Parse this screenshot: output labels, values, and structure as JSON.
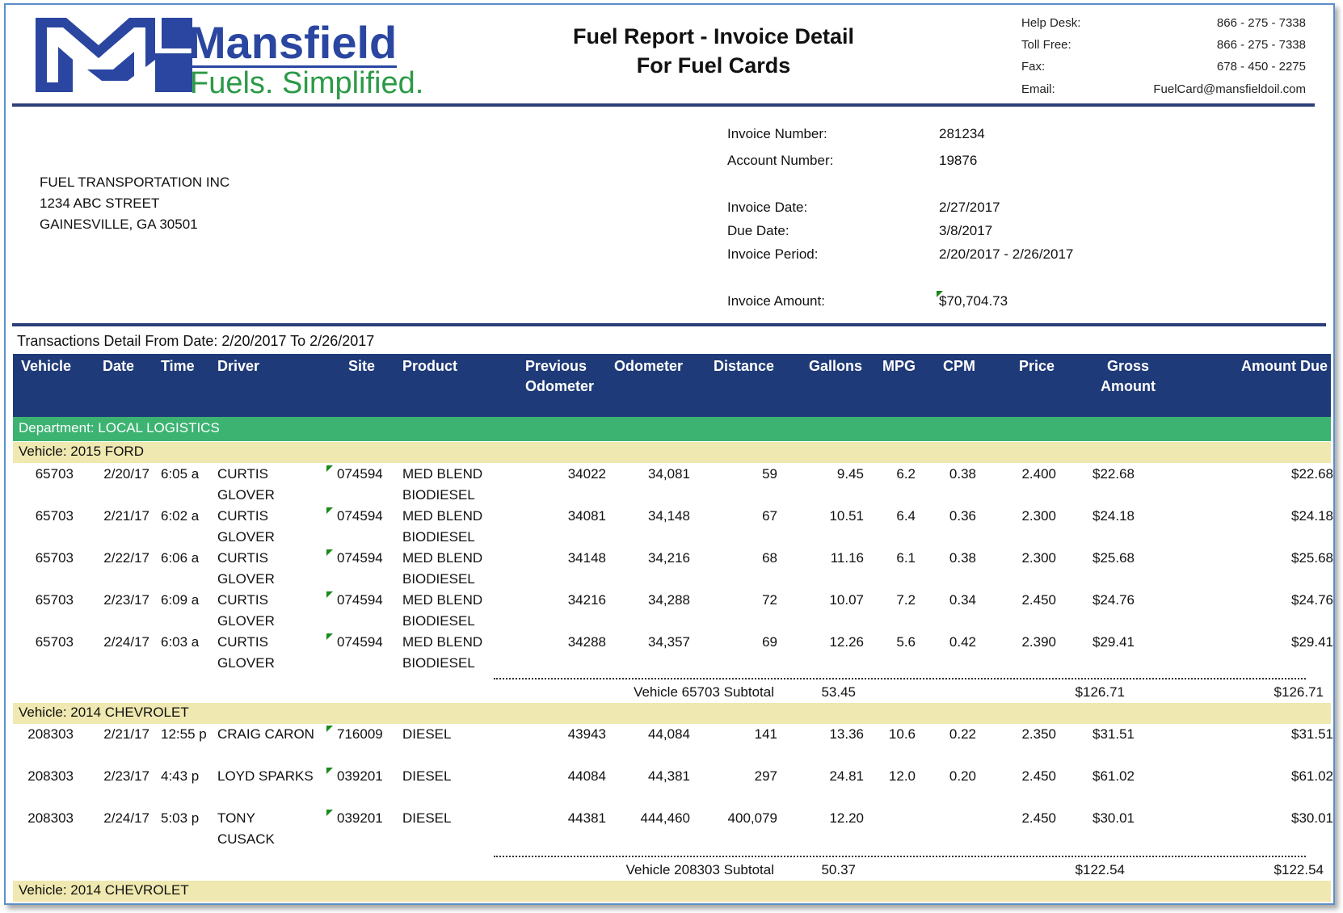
{
  "brand": {
    "name": "Mansfield",
    "tagline": "Fuels. Simplified.",
    "primary_color": "#2a46a0",
    "accent_color": "#2c9a47"
  },
  "report": {
    "title_line1": "Fuel Report - Invoice Detail",
    "title_line2": "For Fuel Cards"
  },
  "contact": [
    {
      "label": "Help Desk:",
      "value": "866 - 275 - 7338"
    },
    {
      "label": "Toll Free:",
      "value": "866 - 275 - 7338"
    },
    {
      "label": "Fax:",
      "value": "678 - 450 - 2275"
    },
    {
      "label": "Email:",
      "value": "FuelCard@mansfieldoil.com"
    }
  ],
  "customer": {
    "name": "FUEL TRANSPORTATION INC",
    "street": "1234 ABC STREET",
    "city": "GAINESVILLE, GA 30501"
  },
  "invoice": {
    "number_label": "Invoice Number:",
    "number": "281234",
    "account_label": "Account Number:",
    "account": "19876",
    "date_label": "Invoice Date:",
    "date": "2/27/2017",
    "due_label": "Due Date:",
    "due": "3/8/2017",
    "period_label": "Invoice Period:",
    "period": "2/20/2017 - 2/26/2017",
    "amount_label": "Invoice Amount:",
    "amount": "$70,704.73"
  },
  "detail_title": "Transactions Detail From Date: 2/20/2017 To 2/26/2017",
  "columns": [
    "Vehicle",
    "Date",
    "Time",
    "Driver",
    "Site",
    "Product",
    "Previous Odometer",
    "Odometer",
    "Distance",
    "Gallons",
    "MPG",
    "CPM",
    "Price",
    "Gross Amount",
    "Amount Due"
  ],
  "department": "Department: LOCAL LOGISTICS",
  "groups": [
    {
      "label": "Vehicle:  2015 FORD",
      "rows": [
        {
          "vehicle": "65703",
          "date": "2/20/17",
          "time": "6:05 a",
          "driver1": "CURTIS",
          "driver2": "GLOVER",
          "site": "074594",
          "product1": "MED BLEND",
          "product2": "BIODIESEL",
          "prev_odo": "34022",
          "odo": "34,081",
          "distance": "59",
          "gallons": "9.45",
          "mpg": "6.2",
          "cpm": "0.38",
          "price": "2.400",
          "gross": "$22.68",
          "due": "$22.68"
        },
        {
          "vehicle": "65703",
          "date": "2/21/17",
          "time": "6:02 a",
          "driver1": "CURTIS",
          "driver2": "GLOVER",
          "site": "074594",
          "product1": "MED BLEND",
          "product2": "BIODIESEL",
          "prev_odo": "34081",
          "odo": "34,148",
          "distance": "67",
          "gallons": "10.51",
          "mpg": "6.4",
          "cpm": "0.36",
          "price": "2.300",
          "gross": "$24.18",
          "due": "$24.18"
        },
        {
          "vehicle": "65703",
          "date": "2/22/17",
          "time": "6:06 a",
          "driver1": "CURTIS",
          "driver2": "GLOVER",
          "site": "074594",
          "product1": "MED BLEND",
          "product2": "BIODIESEL",
          "prev_odo": "34148",
          "odo": "34,216",
          "distance": "68",
          "gallons": "11.16",
          "mpg": "6.1",
          "cpm": "0.38",
          "price": "2.300",
          "gross": "$25.68",
          "due": "$25.68"
        },
        {
          "vehicle": "65703",
          "date": "2/23/17",
          "time": "6:09 a",
          "driver1": "CURTIS",
          "driver2": "GLOVER",
          "site": "074594",
          "product1": "MED BLEND",
          "product2": "BIODIESEL",
          "prev_odo": "34216",
          "odo": "34,288",
          "distance": "72",
          "gallons": "10.07",
          "mpg": "7.2",
          "cpm": "0.34",
          "price": "2.450",
          "gross": "$24.76",
          "due": "$24.76"
        },
        {
          "vehicle": "65703",
          "date": "2/24/17",
          "time": "6:03 a",
          "driver1": "CURTIS",
          "driver2": "GLOVER",
          "site": "074594",
          "product1": "MED BLEND",
          "product2": "BIODIESEL",
          "prev_odo": "34288",
          "odo": "34,357",
          "distance": "69",
          "gallons": "12.26",
          "mpg": "5.6",
          "cpm": "0.42",
          "price": "2.390",
          "gross": "$29.41",
          "due": "$29.41"
        }
      ],
      "subtotal": {
        "label": "Vehicle 65703 Subtotal",
        "gallons": "53.45",
        "gross": "$126.71",
        "due": "$126.71"
      }
    },
    {
      "label": "Vehicle:  2014 CHEVROLET",
      "rows": [
        {
          "vehicle": "208303",
          "date": "2/21/17",
          "time": "12:55 p",
          "driver1": "CRAIG CARON",
          "driver2": "",
          "site": "716009",
          "product1": "DIESEL",
          "product2": "",
          "prev_odo": "43943",
          "odo": "44,084",
          "distance": "141",
          "gallons": "13.36",
          "mpg": "10.6",
          "cpm": "0.22",
          "price": "2.350",
          "gross": "$31.51",
          "due": "$31.51"
        },
        {
          "vehicle": "208303",
          "date": "2/23/17",
          "time": "4:43 p",
          "driver1": "LOYD SPARKS",
          "driver2": "",
          "site": "039201",
          "product1": "DIESEL",
          "product2": "",
          "prev_odo": "44084",
          "odo": "44,381",
          "distance": "297",
          "gallons": "24.81",
          "mpg": "12.0",
          "cpm": "0.20",
          "price": "2.450",
          "gross": "$61.02",
          "due": "$61.02"
        },
        {
          "vehicle": "208303",
          "date": "2/24/17",
          "time": "5:03 p",
          "driver1": "TONY",
          "driver2": "CUSACK",
          "site": "039201",
          "product1": "DIESEL",
          "product2": "",
          "prev_odo": "44381",
          "odo": "444,460",
          "distance": "400,079",
          "gallons": "12.20",
          "mpg": "",
          "cpm": "",
          "price": "2.450",
          "gross": "$30.01",
          "due": "$30.01"
        }
      ],
      "subtotal": {
        "label": "Vehicle 208303 Subtotal",
        "gallons": "50.37",
        "gross": "$122.54",
        "due": "$122.54"
      }
    }
  ],
  "next_group_label": "Vehicle:  2014 CHEVROLET"
}
